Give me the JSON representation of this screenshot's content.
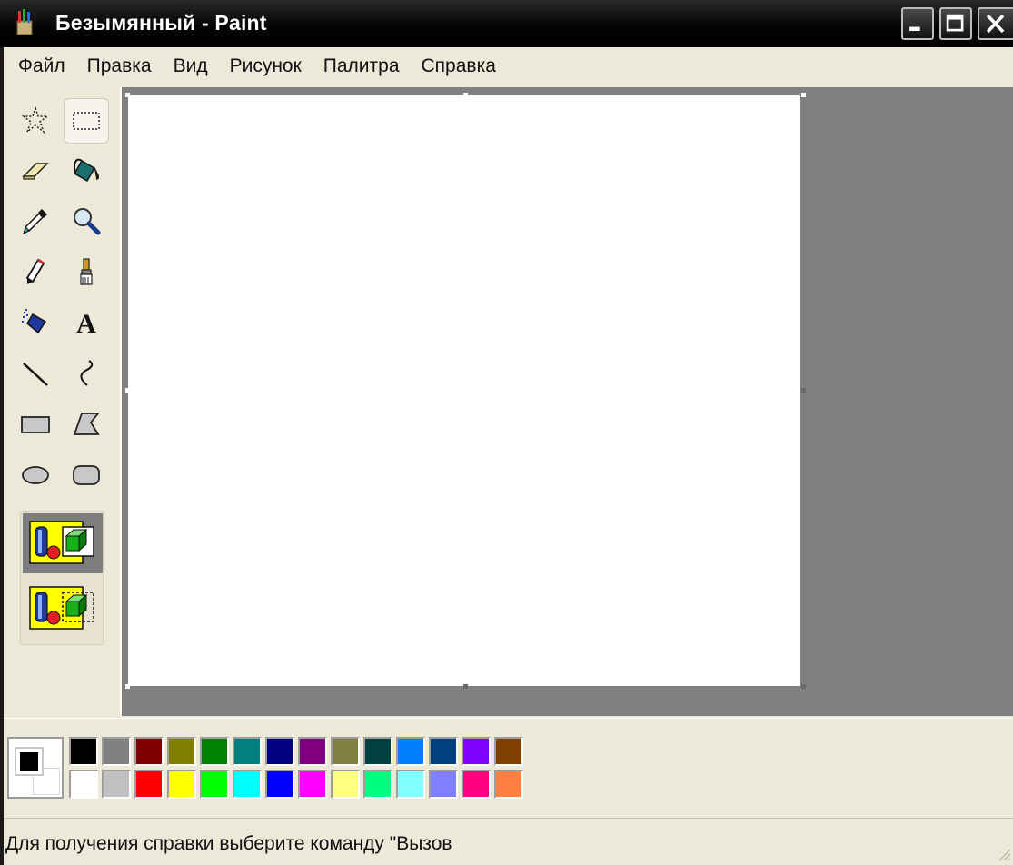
{
  "window": {
    "title": "Безымянный - Paint",
    "icons": {
      "app": "paint-app-icon",
      "minimize": "minimize-icon",
      "maximize": "maximize-icon",
      "close": "close-icon"
    }
  },
  "menu": {
    "items": [
      "Файл",
      "Правка",
      "Вид",
      "Рисунок",
      "Палитра",
      "Справка"
    ]
  },
  "toolbox": {
    "tools": [
      {
        "name": "free-select-icon",
        "selected": false
      },
      {
        "name": "rect-select-icon",
        "selected": true
      },
      {
        "name": "eraser-icon",
        "selected": false
      },
      {
        "name": "fill-bucket-icon",
        "selected": false
      },
      {
        "name": "color-picker-icon",
        "selected": false
      },
      {
        "name": "magnifier-icon",
        "selected": false
      },
      {
        "name": "pencil-icon",
        "selected": false
      },
      {
        "name": "brush-icon",
        "selected": false
      },
      {
        "name": "airbrush-icon",
        "selected": false
      },
      {
        "name": "text-icon",
        "selected": false
      },
      {
        "name": "line-icon",
        "selected": false
      },
      {
        "name": "curve-icon",
        "selected": false
      },
      {
        "name": "rectangle-icon",
        "selected": false
      },
      {
        "name": "polygon-icon",
        "selected": false
      },
      {
        "name": "ellipse-icon",
        "selected": false
      },
      {
        "name": "rounded-rectangle-icon",
        "selected": false
      }
    ],
    "text_tool_glyph": "A",
    "options": [
      {
        "name": "opaque-background-option-icon",
        "active": true
      },
      {
        "name": "transparent-background-option-icon",
        "active": false
      }
    ]
  },
  "palette": {
    "foreground": "#000000",
    "background": "#ffffff",
    "colors_top": [
      "#000000",
      "#808080",
      "#800000",
      "#808000",
      "#008000",
      "#008080",
      "#000080",
      "#800080",
      "#808040",
      "#004040",
      "#0080ff",
      "#004080",
      "#8000ff",
      "#804000"
    ],
    "colors_bottom": [
      "#ffffff",
      "#c0c0c0",
      "#ff0000",
      "#ffff00",
      "#00ff00",
      "#00ffff",
      "#0000ff",
      "#ff00ff",
      "#ffff80",
      "#00ff80",
      "#80ffff",
      "#8080ff",
      "#ff0080",
      "#ff8040"
    ]
  },
  "status": {
    "text": "Для получения справки выберите команду \"Вызов"
  }
}
